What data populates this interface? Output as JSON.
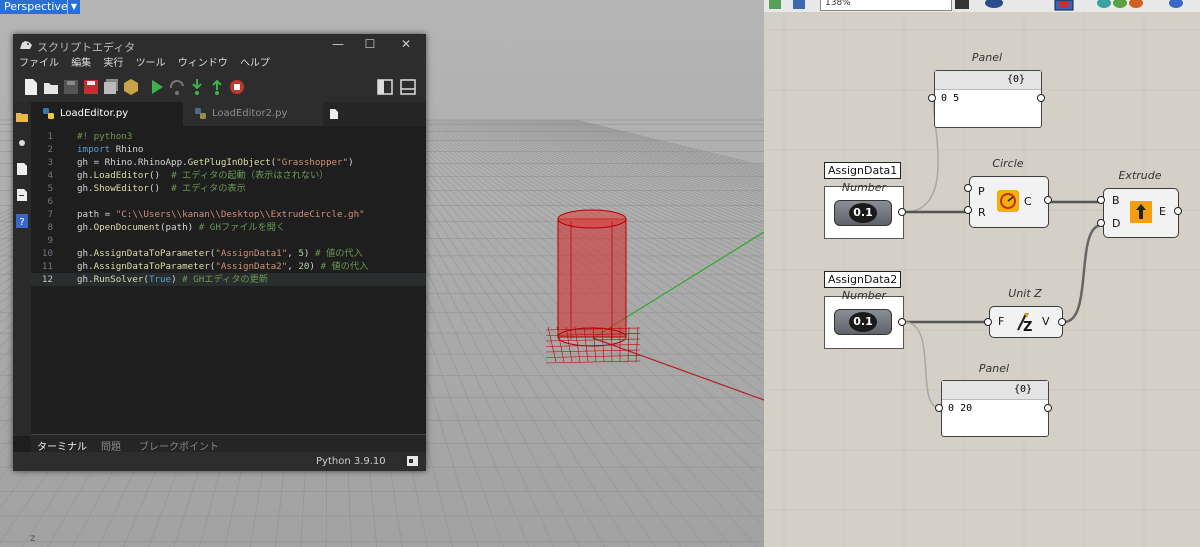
{
  "viewport": {
    "name": "Perspective",
    "axis_label": "z"
  },
  "editor": {
    "title": "スクリプトエディタ",
    "window_buttons": [
      "—",
      "☐",
      "✕"
    ],
    "menu": [
      "ファイル",
      "編集",
      "実行",
      "ツール",
      "ウィンドウ",
      "ヘルプ"
    ],
    "tabs": [
      {
        "label": "LoadEditor.py",
        "active": true
      },
      {
        "label": "LoadEditor2.py",
        "active": false
      }
    ],
    "code_lines": [
      {
        "num": "1",
        "text": "#! python3"
      },
      {
        "num": "2",
        "text": "import Rhino"
      },
      {
        "num": "3",
        "text": "gh = Rhino.RhinoApp.GetPlugInObject(\"Grasshopper\")"
      },
      {
        "num": "4",
        "text": "gh.LoadEditor()  # エディタの起動（表示はされない）"
      },
      {
        "num": "5",
        "text": "gh.ShowEditor()  # エディタの表示"
      },
      {
        "num": "6",
        "text": ""
      },
      {
        "num": "7",
        "text": "path = \"C:\\\\Users\\\\kanan\\\\Desktop\\\\ExtrudeCircle.gh\""
      },
      {
        "num": "8",
        "text": "gh.OpenDocument(path) # GHファイルを開く"
      },
      {
        "num": "9",
        "text": ""
      },
      {
        "num": "10",
        "text": "gh.AssignDataToParameter(\"AssignData1\", 5) # 値の代入"
      },
      {
        "num": "11",
        "text": "gh.AssignDataToParameter(\"AssignData2\", 20) # 値の代入"
      },
      {
        "num": "12",
        "text": "gh.RunSolver(True) # GHエディタの更新"
      }
    ],
    "bottom_tabs": [
      "ターミナル",
      "問題",
      "ブレークポイント"
    ],
    "status": "Python 3.9.10"
  },
  "grasshopper": {
    "zoom": "138%",
    "components": {
      "panel_top": {
        "title": "Panel",
        "header": "{0}",
        "index": "0",
        "value": "5"
      },
      "circle": {
        "title": "Circle",
        "inputs": [
          "P",
          "R"
        ],
        "output": "C"
      },
      "extrude": {
        "title": "Extrude",
        "inputs": [
          "B",
          "D"
        ],
        "output": "E"
      },
      "unitz": {
        "title": "Unit Z",
        "input": "F",
        "output": "V"
      },
      "panel_bottom": {
        "title": "Panel",
        "header": "{0}",
        "index": "0",
        "value": "20"
      }
    },
    "groups": [
      {
        "label": "AssignData1",
        "sublabel": "Number",
        "slider": "0.1"
      },
      {
        "label": "AssignData2",
        "sublabel": "Number",
        "slider": "0.1"
      }
    ]
  },
  "colors": {
    "accent_blue": "#2b6fd6",
    "cylinder_red": "#d91c1c",
    "editor_bg": "#1e1e1e"
  }
}
